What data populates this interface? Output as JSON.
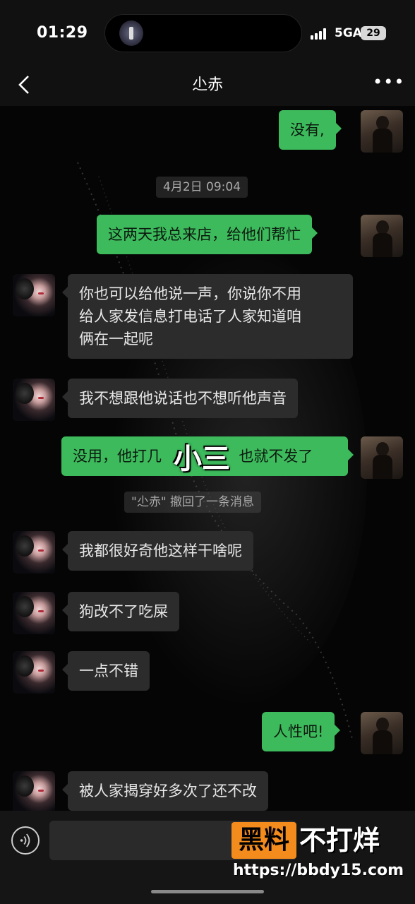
{
  "status_bar": {
    "time": "01:29",
    "network": "5GA",
    "battery": "29"
  },
  "header": {
    "title": "尐赤",
    "back_icon": "chevron-left-icon",
    "more_icon": "ellipsis-icon"
  },
  "timestamp": "4月2日 09:04",
  "system_message": "\"尐赤\" 撤回了一条消息",
  "messages": [
    {
      "side": "out",
      "text": "没有,"
    },
    {
      "side": "out",
      "text": "这两天我总来店，给他们帮忙"
    },
    {
      "side": "in",
      "lines": [
        "你也可以给他说一声，你说你不用",
        "给人家发信息打电话了人家知道咱",
        "俩在一起呢"
      ]
    },
    {
      "side": "in",
      "text": "我不想跟他说话也不想听他声音"
    },
    {
      "side": "out",
      "text": "没用，他打几",
      "text_after": "也就不发了"
    },
    {
      "side": "in",
      "text": "我都很好奇他这样干啥呢"
    },
    {
      "side": "in",
      "text": "狗改不了吃屎"
    },
    {
      "side": "in",
      "text": "一点不错"
    },
    {
      "side": "out",
      "text": "人性吧!"
    },
    {
      "side": "in",
      "text": "被人家揭穿好多次了还不改"
    }
  ],
  "overlay_caption": "小三",
  "watermark": {
    "brand_black": "黑料",
    "brand_white": "不打烊",
    "url": "https://bbdy15.com",
    "accent_color": "#f38b1d"
  },
  "colors": {
    "outgoing_bubble": "#3dbb5c",
    "incoming_bubble": "#2c2c2c"
  }
}
